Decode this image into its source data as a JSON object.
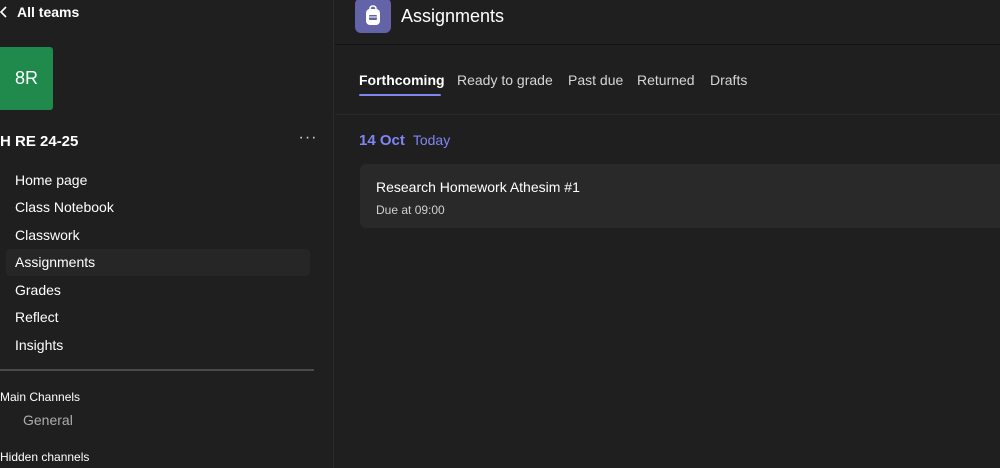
{
  "sidebar": {
    "back_label": "All teams",
    "avatar_text": "8R",
    "team_name": "H RE 24-25",
    "more_label": "···",
    "items": [
      {
        "label": "Home page"
      },
      {
        "label": "Class Notebook"
      },
      {
        "label": "Classwork"
      },
      {
        "label": "Assignments",
        "active": true
      },
      {
        "label": "Grades"
      },
      {
        "label": "Reflect"
      },
      {
        "label": "Insights"
      }
    ],
    "main_channels_heading": "Main Channels",
    "channels": [
      {
        "label": "General"
      }
    ],
    "hidden_channels_heading": "Hidden channels"
  },
  "header": {
    "app_title": "Assignments",
    "app_icon": "backpack-icon"
  },
  "tabs": [
    {
      "label": "Forthcoming",
      "active": true
    },
    {
      "label": "Ready to grade"
    },
    {
      "label": "Past due"
    },
    {
      "label": "Returned"
    },
    {
      "label": "Drafts"
    }
  ],
  "assignments": {
    "date": "14 Oct",
    "date_note": "Today",
    "items": [
      {
        "title": "Research Homework Athesim #1",
        "due": "Due at 09:00"
      }
    ]
  },
  "colors": {
    "accent": "#7f85f5",
    "team_avatar": "#1f8a4c",
    "app_icon_bg": "#6264a7",
    "background": "#1f1f1f",
    "card": "#292929"
  }
}
